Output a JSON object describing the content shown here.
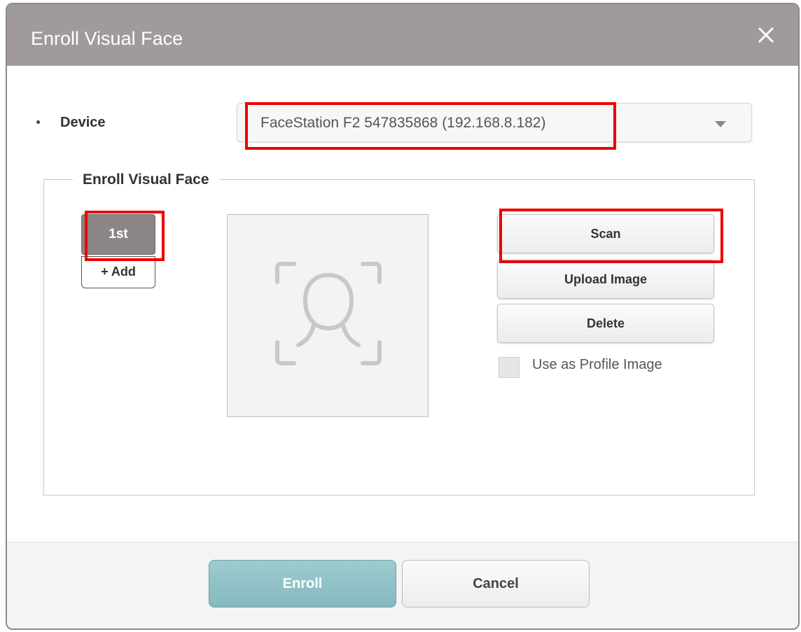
{
  "dialog": {
    "title": "Enroll Visual Face",
    "close_icon": "close-icon"
  },
  "device": {
    "label": "Device",
    "selected": "FaceStation F2 547835868 (192.168.8.182)",
    "caret_icon": "chevron-down-icon"
  },
  "enroll_section": {
    "legend": "Enroll Visual Face",
    "slots": [
      {
        "label": "1st",
        "selected": true
      }
    ],
    "add_label": "+ Add",
    "preview_icon": "face-scan-icon"
  },
  "actions": {
    "scan_label": "Scan",
    "upload_label": "Upload Image",
    "delete_label": "Delete",
    "profile_checkbox_label": "Use as Profile Image",
    "profile_checked": false
  },
  "footer": {
    "enroll_label": "Enroll",
    "cancel_label": "Cancel"
  },
  "colors": {
    "titlebar": "#a09a9b",
    "highlight": "#ee0000",
    "enroll_button": "#8fc0c6",
    "selected_slot": "#8c8586"
  }
}
